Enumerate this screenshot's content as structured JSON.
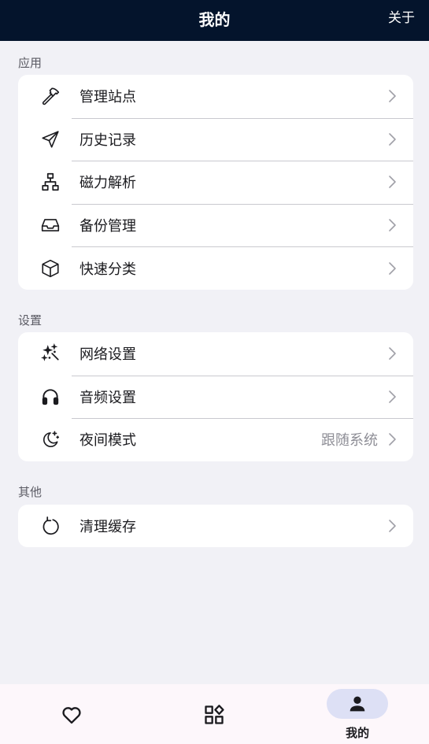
{
  "header": {
    "title": "我的",
    "action_label": "关于"
  },
  "sections": [
    {
      "label": "应用",
      "items": [
        {
          "label": "管理站点",
          "icon": "hammer-icon"
        },
        {
          "label": "历史记录",
          "icon": "send-icon"
        },
        {
          "label": "磁力解析",
          "icon": "sitemap-icon"
        },
        {
          "label": "备份管理",
          "icon": "inbox-icon"
        },
        {
          "label": "快速分类",
          "icon": "cube-icon"
        }
      ]
    },
    {
      "label": "设置",
      "items": [
        {
          "label": "网络设置",
          "icon": "sparkles-icon"
        },
        {
          "label": "音频设置",
          "icon": "headphones-icon"
        },
        {
          "label": "夜间模式",
          "icon": "moon-stars-icon",
          "value": "跟随系统"
        }
      ]
    },
    {
      "label": "其他",
      "items": [
        {
          "label": "清理缓存",
          "icon": "refresh-icon"
        }
      ]
    }
  ],
  "bottom_nav": [
    {
      "label": "",
      "icon": "heart-icon",
      "active": false
    },
    {
      "label": "",
      "icon": "apps-icon",
      "active": false
    },
    {
      "label": "我的",
      "icon": "person-icon",
      "active": true
    }
  ],
  "colors": {
    "header_bg": "#04142c",
    "page_bg": "#f1f1f6",
    "card_bg": "#ffffff",
    "active_nav_pill": "#dde0f5",
    "secondary_text": "#8e8e96"
  }
}
